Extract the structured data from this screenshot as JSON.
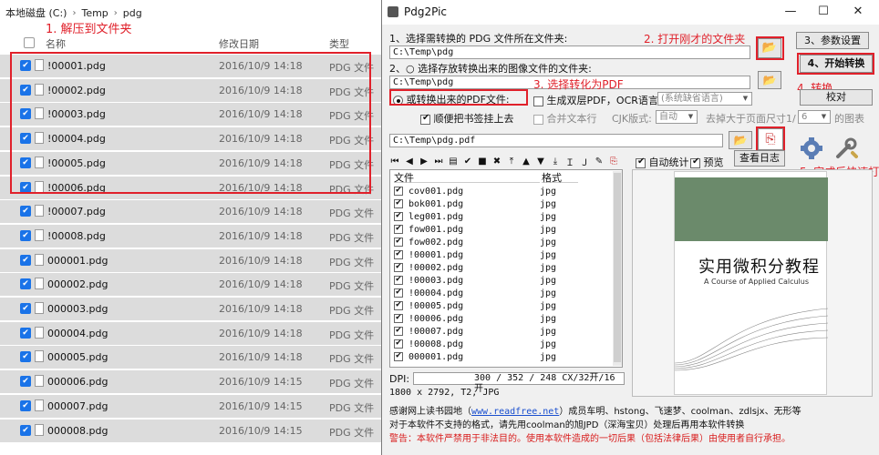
{
  "explorer": {
    "breadcrumb": [
      "本地磁盘 (C:)",
      "Temp",
      "pdg"
    ],
    "columns": {
      "name": "名称",
      "date": "修改日期",
      "type": "类型"
    },
    "files": [
      {
        "name": "!00001.pdg",
        "date": "2016/10/9 14:18",
        "type": "PDG 文件"
      },
      {
        "name": "!00002.pdg",
        "date": "2016/10/9 14:18",
        "type": "PDG 文件"
      },
      {
        "name": "!00003.pdg",
        "date": "2016/10/9 14:18",
        "type": "PDG 文件"
      },
      {
        "name": "!00004.pdg",
        "date": "2016/10/9 14:18",
        "type": "PDG 文件"
      },
      {
        "name": "!00005.pdg",
        "date": "2016/10/9 14:18",
        "type": "PDG 文件"
      },
      {
        "name": "!00006.pdg",
        "date": "2016/10/9 14:18",
        "type": "PDG 文件"
      },
      {
        "name": "!00007.pdg",
        "date": "2016/10/9 14:18",
        "type": "PDG 文件"
      },
      {
        "name": "!00008.pdg",
        "date": "2016/10/9 14:18",
        "type": "PDG 文件"
      },
      {
        "name": "000001.pdg",
        "date": "2016/10/9 14:18",
        "type": "PDG 文件"
      },
      {
        "name": "000002.pdg",
        "date": "2016/10/9 14:18",
        "type": "PDG 文件"
      },
      {
        "name": "000003.pdg",
        "date": "2016/10/9 14:18",
        "type": "PDG 文件"
      },
      {
        "name": "000004.pdg",
        "date": "2016/10/9 14:18",
        "type": "PDG 文件"
      },
      {
        "name": "000005.pdg",
        "date": "2016/10/9 14:18",
        "type": "PDG 文件"
      },
      {
        "name": "000006.pdg",
        "date": "2016/10/9 14:15",
        "type": "PDG 文件"
      },
      {
        "name": "000007.pdg",
        "date": "2016/10/9 14:15",
        "type": "PDG 文件"
      },
      {
        "name": "000008.pdg",
        "date": "2016/10/9 14:15",
        "type": "PDG 文件"
      }
    ]
  },
  "annotations": {
    "a1": "1. 解压到文件夹",
    "a2": "2. 打开刚才的文件夹",
    "a3": "3. 选择转化为PDF",
    "a4": "4. 转换",
    "a5": "5. 完成后快速打开"
  },
  "dialog": {
    "title": "Pdg2Pic",
    "step1_label": "1、选择需转换的 PDG 文件所在文件夹:",
    "step1_path": "C:\\Temp\\pdg",
    "step2_label": "2、○ 选择存放转换出来的图像文件的文件夹:",
    "step2_path": "C:\\Temp\\pdg",
    "btn_params": "3、参数设置",
    "btn_start": "4、开始转换",
    "btn_proofread": "校对",
    "radio_pdf": "或转换出来的PDF文件:",
    "chk_double": "生成双层PDF，OCR语言:",
    "ocr_lang": "(系统缺省语言)",
    "chk_bookmark": "顺便把书签挂上去",
    "chk_merge": "合并文本行",
    "cjk_label": "CJK版式:",
    "cjk_value": "自动",
    "skip_label": "去掉大于页面尺寸1/",
    "skip_value": "6",
    "skip_suffix": "的图表",
    "pdf_path": "C:\\Temp\\pdg.pdf",
    "chk_autostat": "自动统计",
    "chk_preview": "预览",
    "btn_log": "查看日志",
    "list_headers": {
      "file": "文件",
      "format": "格式"
    },
    "list_rows": [
      {
        "name": "cov001.pdg",
        "fmt": "jpg"
      },
      {
        "name": "bok001.pdg",
        "fmt": "jpg"
      },
      {
        "name": "leg001.pdg",
        "fmt": "jpg"
      },
      {
        "name": "fow001.pdg",
        "fmt": "jpg"
      },
      {
        "name": "fow002.pdg",
        "fmt": "jpg"
      },
      {
        "name": "!00001.pdg",
        "fmt": "jpg"
      },
      {
        "name": "!00002.pdg",
        "fmt": "jpg"
      },
      {
        "name": "!00003.pdg",
        "fmt": "jpg"
      },
      {
        "name": "!00004.pdg",
        "fmt": "jpg"
      },
      {
        "name": "!00005.pdg",
        "fmt": "jpg"
      },
      {
        "name": "!00006.pdg",
        "fmt": "jpg"
      },
      {
        "name": "!00007.pdg",
        "fmt": "jpg"
      },
      {
        "name": "!00008.pdg",
        "fmt": "jpg"
      },
      {
        "name": "000001.pdg",
        "fmt": "jpg"
      }
    ],
    "dpi_label": "DPI:",
    "dpi_value": "300 / 352 / 248 CX/32开/16开",
    "info_line": "1800 x 2792, T2, JPG",
    "credit1_pre": "感谢网上读书园地（",
    "credit1_link": "www.readfree.net",
    "credit1_post": "）成员车明、hstong、飞速梦、coolman、zdlsjx、无形等",
    "credit2": "对于本软件不支持的格式，请先用coolman的旭JPD（深海宝贝）处理后再用本软件转换",
    "credit3": "警告：本软件严禁用于非法目的。使用本软件造成的一切后果（包括法律后果）由使用者自行承担。"
  },
  "book": {
    "title": "实用微积分教程",
    "subtitle": "A Course of Applied Calculus"
  }
}
